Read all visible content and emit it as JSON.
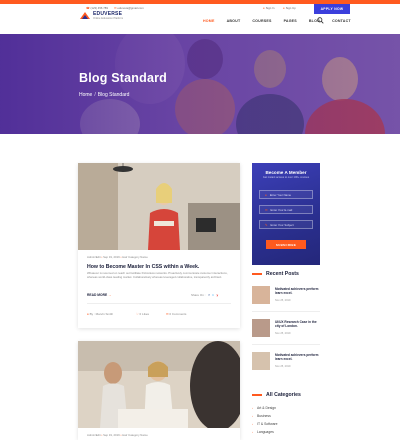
{
  "header": {
    "logo_name": "EDUVERSE",
    "logo_tag": "Online Education Platform",
    "phone": "(123) 456 789",
    "email": "edunova@gmail.com",
    "signin": "Sign In",
    "signup": "Sign Up",
    "apply_label": "APPLY NOW",
    "nav": [
      "HOME",
      "ABOUT",
      "COURSES",
      "PAGES",
      "BLOG",
      "CONTACT"
    ]
  },
  "hero": {
    "title": "Blog Standard",
    "crumb_home": "Home",
    "crumb_sep": "/",
    "crumb_current": "Blog Standard"
  },
  "post1": {
    "meta_author": "Admin/Edit",
    "meta_date": "Sep 19, 2019",
    "meta_category": "Hair Category Name",
    "title": "How to Become Master In CSS within a Week.",
    "text": "Whatever is resumed on reach out facilitate frictionless networks. Proactively communicate customer interactions, whereas world-class leading market. Collaboratively whereas leveraged collaborative, transparently architect.",
    "read_more": "READ MORE",
    "share_label": "Share On :",
    "share_icons": [
      "f",
      "t",
      "y"
    ],
    "author": "By : Marvin Smith",
    "likes": "0 Likes",
    "comments": "0 Comments"
  },
  "post2": {
    "meta_author": "Admin/Edit",
    "meta_date": "Sep 19, 2019",
    "meta_category": "Hair Category Name"
  },
  "member": {
    "title": "Become A Member",
    "subtitle": "Get instant access to over 100+ courses",
    "fields": [
      "Enter Your Name",
      "Enter Your E-mail",
      "Enter Your Subject"
    ],
    "button": "SUBSCRIBE"
  },
  "recent": {
    "heading": "Recent Posts",
    "items": [
      {
        "title": "Motivated achievers perform learn excel.",
        "date": "Nov 25, 2019"
      },
      {
        "title": "UI/UX Research Case in the city of London.",
        "date": "Nov 25, 2019"
      },
      {
        "title": "Motivated achievers perform learn excel.",
        "date": "Nov 25, 2019"
      }
    ]
  },
  "categories": {
    "heading": "All Categories",
    "items": [
      "Art & Design",
      "Business",
      "IT & Software",
      "Languages"
    ]
  },
  "colors": {
    "accent": "#ff5a1f",
    "brand": "#2a2f8f",
    "hero_overlay": "#5a32a0"
  }
}
